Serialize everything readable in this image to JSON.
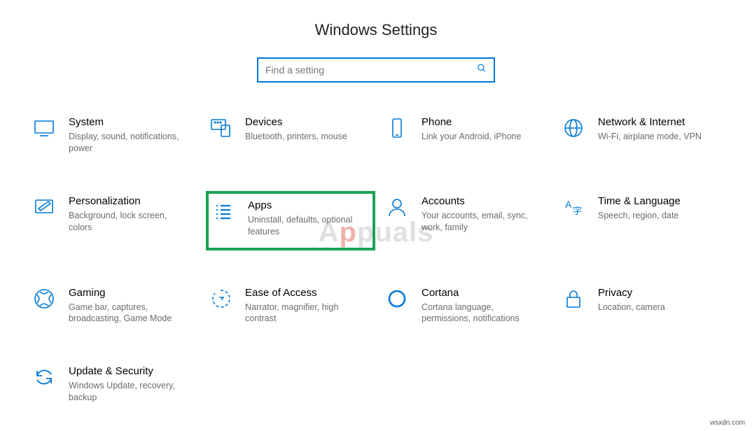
{
  "header": {
    "title": "Windows Settings"
  },
  "search": {
    "placeholder": "Find a setting"
  },
  "tiles": {
    "system": {
      "title": "System",
      "desc": "Display, sound, notifications, power"
    },
    "devices": {
      "title": "Devices",
      "desc": "Bluetooth, printers, mouse"
    },
    "phone": {
      "title": "Phone",
      "desc": "Link your Android, iPhone"
    },
    "network": {
      "title": "Network & Internet",
      "desc": "Wi-Fi, airplane mode, VPN"
    },
    "personalization": {
      "title": "Personalization",
      "desc": "Background, lock screen, colors"
    },
    "apps": {
      "title": "Apps",
      "desc": "Uninstall, defaults, optional features"
    },
    "accounts": {
      "title": "Accounts",
      "desc": "Your accounts, email, sync, work, family"
    },
    "time": {
      "title": "Time & Language",
      "desc": "Speech, region, date"
    },
    "gaming": {
      "title": "Gaming",
      "desc": "Game bar, captures, broadcasting, Game Mode"
    },
    "ease": {
      "title": "Ease of Access",
      "desc": "Narrator, magnifier, high contrast"
    },
    "cortana": {
      "title": "Cortana",
      "desc": "Cortana language, permissions, notifications"
    },
    "privacy": {
      "title": "Privacy",
      "desc": "Location, camera"
    },
    "update": {
      "title": "Update & Security",
      "desc": "Windows Update, recovery, backup"
    }
  },
  "attribution": "wsxdn.com",
  "watermark": {
    "prefix": "A",
    "highlight": "p",
    "suffix": "puals"
  }
}
